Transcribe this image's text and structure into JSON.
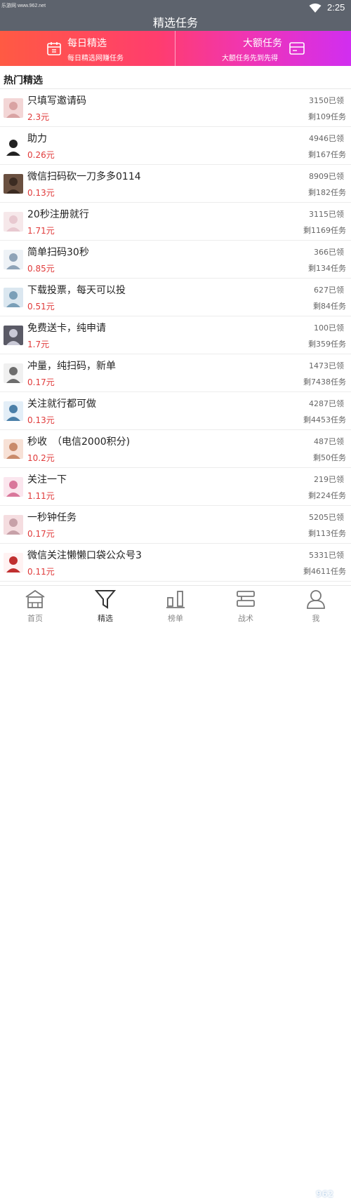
{
  "status": {
    "source": "乐游网 www.962.net",
    "time": "2:25"
  },
  "header": {
    "title": "精选任务"
  },
  "banner": {
    "daily": {
      "title": "每日精选",
      "subtitle": "每日精选网赚任务",
      "icon": "calendar-icon"
    },
    "big": {
      "title": "大额任务",
      "subtitle": "大额任务先到先得",
      "icon": "card-icon"
    },
    "colors": {
      "start": "#ff5a43",
      "end": "#d12ef0"
    }
  },
  "section": {
    "title": "热门精选"
  },
  "tasks": [
    {
      "name": "只填写邀请码",
      "price": "2.3元",
      "claimed": "3150已领",
      "remaining": "剩109任务"
    },
    {
      "name": "助力",
      "price": "0.26元",
      "claimed": "4946已领",
      "remaining": "剩167任务"
    },
    {
      "name": "微信扫码砍一刀多多0114",
      "price": "0.13元",
      "claimed": "8909已领",
      "remaining": "剩182任务"
    },
    {
      "name": "20秒注册就行",
      "price": "1.71元",
      "claimed": "3115已领",
      "remaining": "剩1169任务"
    },
    {
      "name": "简单扫码30秒",
      "price": "0.85元",
      "claimed": "366已领",
      "remaining": "剩134任务"
    },
    {
      "name": "下载投票，每天可以投",
      "price": "0.51元",
      "claimed": "627已领",
      "remaining": "剩84任务"
    },
    {
      "name": "免费送卡，纯申请",
      "price": "1.7元",
      "claimed": "100已领",
      "remaining": "剩359任务"
    },
    {
      "name": "冲量，纯扫码，新单",
      "price": "0.17元",
      "claimed": "1473已领",
      "remaining": "剩7438任务"
    },
    {
      "name": "关注就行都可做",
      "price": "0.13元",
      "claimed": "4287已领",
      "remaining": "剩4453任务"
    },
    {
      "name": "秒收　（电信2000积分)",
      "price": "10.2元",
      "claimed": "487已领",
      "remaining": "剩50任务"
    },
    {
      "name": "关注一下",
      "price": "1.11元",
      "claimed": "219已领",
      "remaining": "剩224任务"
    },
    {
      "name": "一秒钟任务",
      "price": "0.17元",
      "claimed": "5205已领",
      "remaining": "剩113任务"
    },
    {
      "name": "微信关注懒懒口袋公众号3",
      "price": "0.11元",
      "claimed": "5331已领",
      "remaining": "剩4611任务"
    }
  ],
  "tabs": [
    {
      "label": "首页",
      "icon": "home-icon"
    },
    {
      "label": "精选",
      "icon": "filter-icon"
    },
    {
      "label": "榜单",
      "icon": "chart-icon"
    },
    {
      "label": "战术",
      "icon": "strategy-icon"
    },
    {
      "label": "我",
      "icon": "user-icon"
    }
  ],
  "watermark": "962"
}
